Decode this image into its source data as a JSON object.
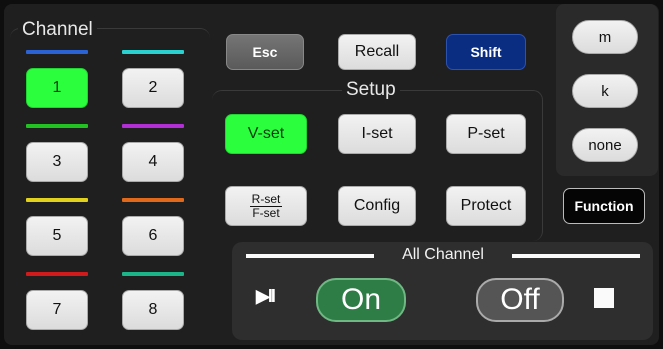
{
  "channel": {
    "label": "Channel",
    "channels": [
      {
        "label": "1",
        "color": "#2b63d4",
        "selected": true
      },
      {
        "label": "2",
        "color": "#2bd0d0",
        "selected": false
      },
      {
        "label": "3",
        "color": "#22c222",
        "selected": false
      },
      {
        "label": "4",
        "color": "#b22fd6",
        "selected": false
      },
      {
        "label": "5",
        "color": "#e2d11d",
        "selected": false
      },
      {
        "label": "6",
        "color": "#e0691c",
        "selected": false
      },
      {
        "label": "7",
        "color": "#cf1b1b",
        "selected": false
      },
      {
        "label": "8",
        "color": "#1cb58a",
        "selected": false
      }
    ]
  },
  "top": {
    "esc": "Esc",
    "recall": "Recall",
    "shift": "Shift"
  },
  "setup": {
    "label": "Setup",
    "vset": "V-set",
    "iset": "I-set",
    "pset": "P-set",
    "rset_top": "R-set",
    "rset_bottom": "F-set",
    "config": "Config",
    "protect": "Protect"
  },
  "units": {
    "m": "m",
    "k": "k",
    "none": "none"
  },
  "function": "Function",
  "all_channel": {
    "label": "All Channel",
    "on": "On",
    "off": "Off",
    "play_pause": "▶II",
    "stop": "■"
  },
  "colors": {
    "accent_green": "#2bff3d",
    "shift_blue": "#0a2d82",
    "on_green": "#2e7d46"
  }
}
